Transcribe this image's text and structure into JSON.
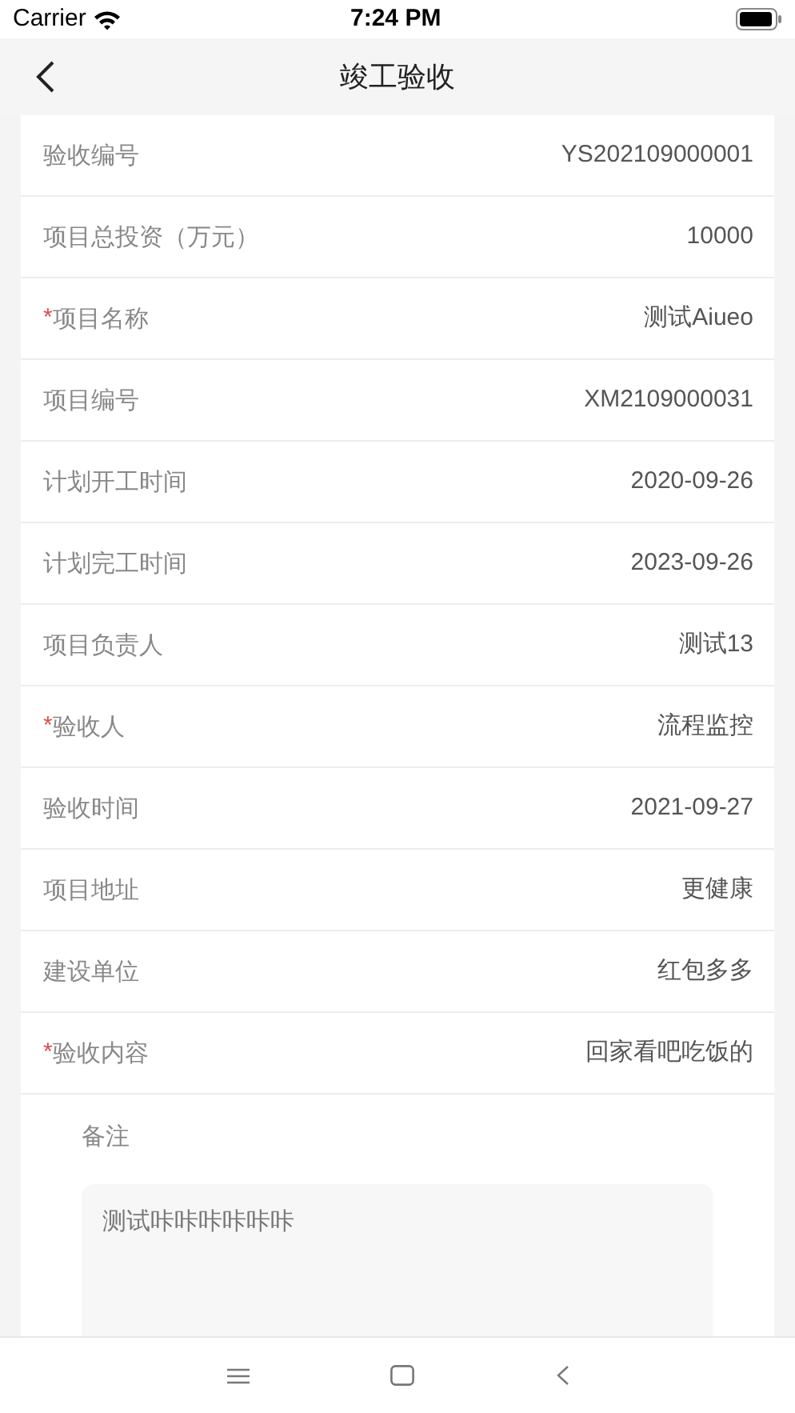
{
  "status_bar": {
    "carrier": "Carrier",
    "time": "7:24 PM"
  },
  "header": {
    "title": "竣工验收"
  },
  "fields": [
    {
      "label": "验收编号",
      "value": "YS202109000001"
    },
    {
      "label": "项目总投资（万元）",
      "value": "10000"
    },
    {
      "label": "项目名称",
      "required_mark": "*",
      "value": "测试Aiueo"
    },
    {
      "label": "项目编号",
      "value": "XM2109000031"
    },
    {
      "label": "计划开工时间",
      "value": "2020-09-26"
    },
    {
      "label": "计划完工时间",
      "value": "2023-09-26"
    },
    {
      "label": "项目负责人",
      "value": "测试13"
    },
    {
      "label": "验收人",
      "required_mark": "*",
      "value": "流程监控"
    },
    {
      "label": "验收时间",
      "value": "2021-09-27"
    },
    {
      "label": "项目地址",
      "value": "更健康"
    },
    {
      "label": "建设单位",
      "value": "红包多多"
    },
    {
      "label": "验收内容",
      "required_mark": "*",
      "value": "回家看吧吃饭的"
    }
  ],
  "remarks": {
    "label": "备注",
    "value": "测试咔咔咔咔咔咔"
  }
}
